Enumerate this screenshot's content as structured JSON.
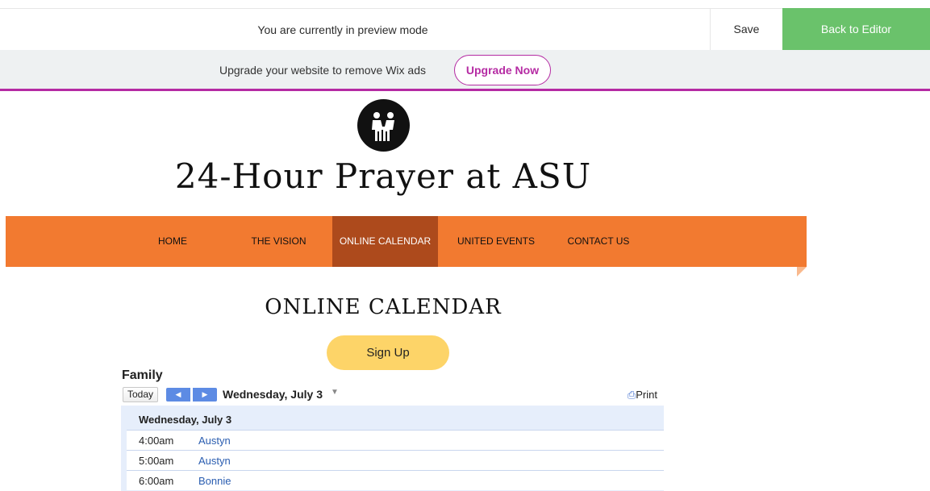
{
  "preview_bar": {
    "message": "You are currently in preview mode",
    "save_label": "Save",
    "back_label": "Back to Editor"
  },
  "upgrade_bar": {
    "message": "Upgrade your website to remove Wix ads",
    "button_label": "Upgrade Now"
  },
  "site": {
    "title": "24-Hour Prayer at ASU",
    "logo_icon": "people-holding-hands-icon"
  },
  "nav": {
    "items": [
      {
        "label": "HOME"
      },
      {
        "label": "THE VISION"
      },
      {
        "label": "ONLINE CALENDAR",
        "active": true
      },
      {
        "label": "UNITED EVENTS"
      },
      {
        "label": "CONTACT US"
      }
    ]
  },
  "page": {
    "heading": "ONLINE CALENDAR",
    "signup_label": "Sign Up"
  },
  "calendar": {
    "name": "Family",
    "today_label": "Today",
    "current_date": "Wednesday, July 3",
    "print_label": "Print",
    "day_header": "Wednesday, July 3",
    "events": [
      {
        "time": "4:00am",
        "title": "Austyn"
      },
      {
        "time": "5:00am",
        "title": "Austyn"
      },
      {
        "time": "6:00am",
        "title": "Bonnie"
      }
    ]
  },
  "colors": {
    "nav_bg": "#f27a30",
    "nav_active": "#ad4a1c",
    "back_button": "#6ac26b",
    "upgrade_accent": "#b52ba3",
    "signup_button": "#fdd468"
  }
}
